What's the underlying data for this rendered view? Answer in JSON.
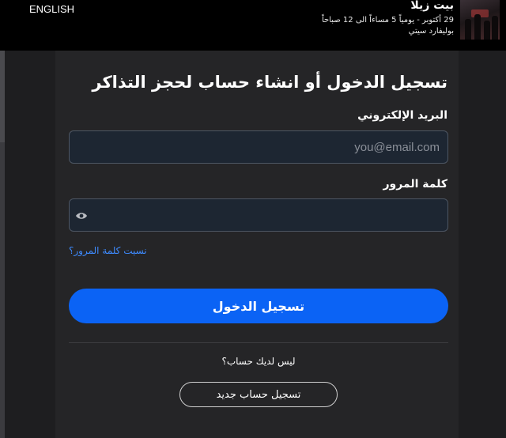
{
  "header": {
    "language_link": "ENGLISH",
    "event": {
      "title": "بيت زيلا",
      "date": "29 أكتوبر - يومياً 5 مساءاً الى 12 صباحاً",
      "venue": "بوليفارد سيتي"
    }
  },
  "login": {
    "title": "تسجيل الدخول أو انشاء حساب لحجز التذاكر",
    "email_label": "البريد الإلكتروني",
    "email_placeholder": "you@email.com",
    "email_value": "",
    "password_label": "كلمة المرور",
    "password_value": "",
    "forgot_link": "نسيت كلمة المرور؟",
    "submit_label": "تسجيل الدخول",
    "no_account_text": "ليس لديك حساب؟",
    "register_label": "تسجيل حساب جديد"
  },
  "colors": {
    "primary": "#0b63f5",
    "link": "#3e8bff",
    "input_bg": "#1d2632"
  },
  "icons": {
    "password_toggle": "eye-icon",
    "event_thumbnail": "event-poster-image"
  }
}
